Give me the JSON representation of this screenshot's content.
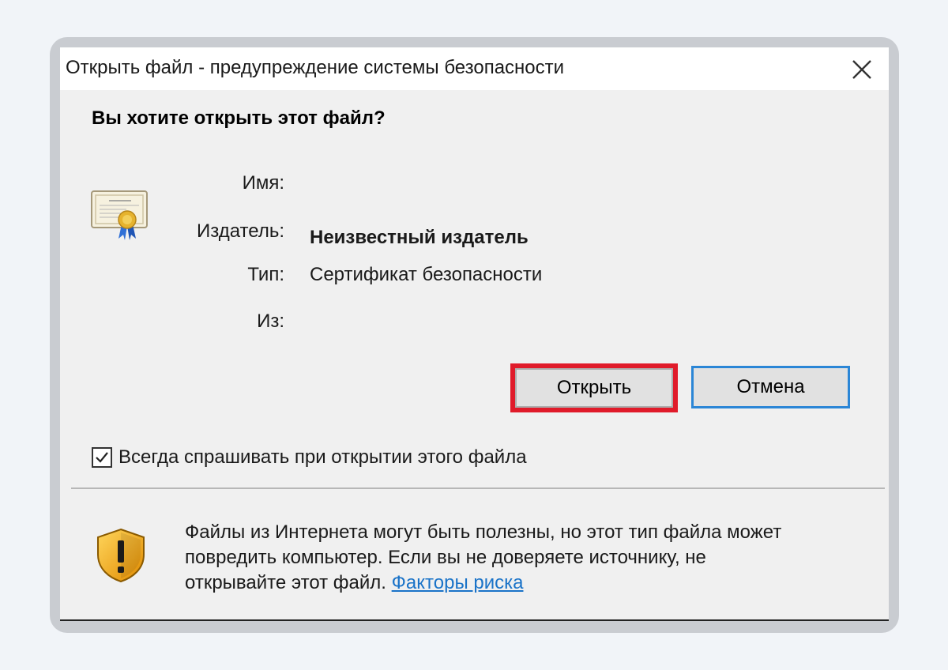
{
  "window": {
    "title": "Открыть файл - предупреждение системы безопасности",
    "close_icon": "close-icon"
  },
  "question": "Вы хотите открыть этот файл?",
  "file_info": {
    "icon": "certificate-icon",
    "name_label": "Имя:",
    "name_value": "",
    "publisher_label": "Издатель:",
    "publisher_value": "Неизвестный издатель",
    "type_label": "Тип:",
    "type_value": "Сертификат безопасности",
    "from_label": "Из:",
    "from_value": ""
  },
  "buttons": {
    "open_label": "Открыть",
    "cancel_label": "Отмена",
    "highlight_color": "#e01b2a",
    "focus_color": "#2b86d6"
  },
  "checkbox": {
    "label": "Всегда спрашивать при открытии этого файла",
    "checked": true
  },
  "warning": {
    "icon": "shield-warning-icon",
    "line1": "Файлы из Интернета могут быть полезны, но этот тип файла может",
    "line2": "повредить компьютер. Если вы не доверяете источнику, не",
    "line3": "открывайте этот файл.",
    "link_label": "Факторы риска",
    "link_color": "#1a73c8"
  }
}
